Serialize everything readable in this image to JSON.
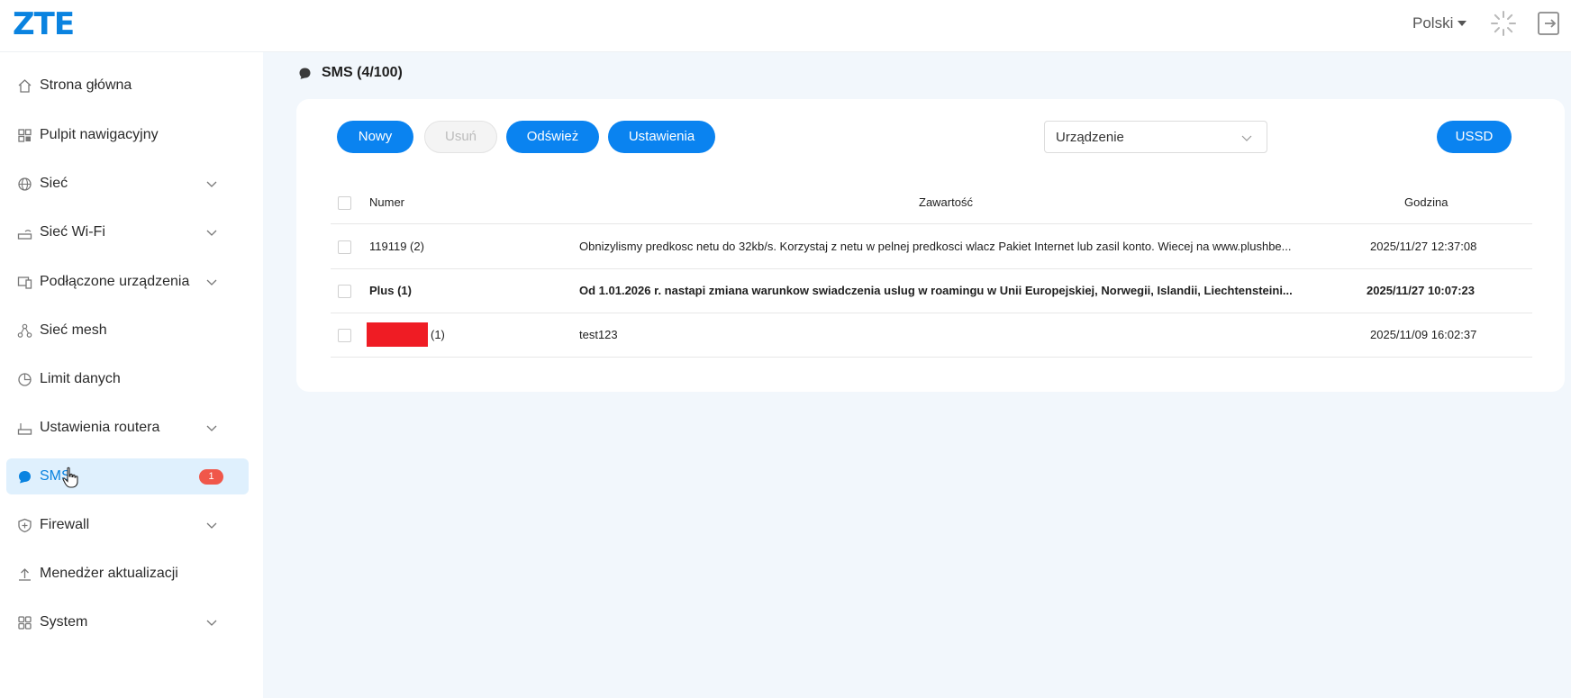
{
  "header": {
    "logo": "ZTE",
    "language": "Polski"
  },
  "sidebar": {
    "items": [
      {
        "label": "Strona główna",
        "icon": "home-icon",
        "expandable": false
      },
      {
        "label": "Pulpit nawigacyjny",
        "icon": "dashboard-icon",
        "expandable": false
      },
      {
        "label": "Sieć",
        "icon": "globe-icon",
        "expandable": true
      },
      {
        "label": "Sieć Wi-Fi",
        "icon": "router-wifi-icon",
        "expandable": true
      },
      {
        "label": "Podłączone urządzenia",
        "icon": "devices-icon",
        "expandable": true
      },
      {
        "label": "Sieć mesh",
        "icon": "mesh-icon",
        "expandable": false
      },
      {
        "label": "Limit danych",
        "icon": "pie-icon",
        "expandable": false
      },
      {
        "label": "Ustawienia routera",
        "icon": "router-icon",
        "expandable": true
      },
      {
        "label": "SMS",
        "icon": "message-icon",
        "expandable": false,
        "active": true,
        "badge": "1"
      },
      {
        "label": "Firewall",
        "icon": "shield-icon",
        "expandable": true
      },
      {
        "label": "Menedżer aktualizacji",
        "icon": "upload-icon",
        "expandable": false
      },
      {
        "label": "System",
        "icon": "grid-icon",
        "expandable": true
      }
    ]
  },
  "page": {
    "title": "SMS (4/100)"
  },
  "toolbar": {
    "new_label": "Nowy",
    "delete_label": "Usuń",
    "refresh_label": "Odśwież",
    "settings_label": "Ustawienia",
    "ussd_label": "USSD",
    "location_select": "Urządzenie"
  },
  "table": {
    "headers": {
      "number": "Numer",
      "content": "Zawartość",
      "time": "Godzina"
    },
    "rows": [
      {
        "number": "119119 (2)",
        "content": "Obnizylismy predkosc netu do 32kb/s. Korzystaj z netu w pelnej predkosci wlacz Pakiet Internet lub zasil konto. Wiecej na www.plushbe...",
        "time": "2025/11/27 12:37:08",
        "unread": false,
        "redacted": false
      },
      {
        "number": "Plus (1)",
        "content": "Od 1.01.2026 r. nastapi zmiana warunkow swiadczenia uslug w roamingu w Unii Europejskiej, Norwegii, Islandii, Liechtensteini...",
        "time": "2025/11/27 10:07:23",
        "unread": true,
        "redacted": false
      },
      {
        "number": "(1)",
        "content": "test123",
        "time": "2025/11/09 16:02:37",
        "unread": false,
        "redacted": true
      }
    ]
  },
  "colors": {
    "brand": "#0a83e0",
    "button": "#0a83f0",
    "badge": "#f0574a",
    "redaction": "#ef1c24",
    "active_bg": "#dff0fd"
  }
}
